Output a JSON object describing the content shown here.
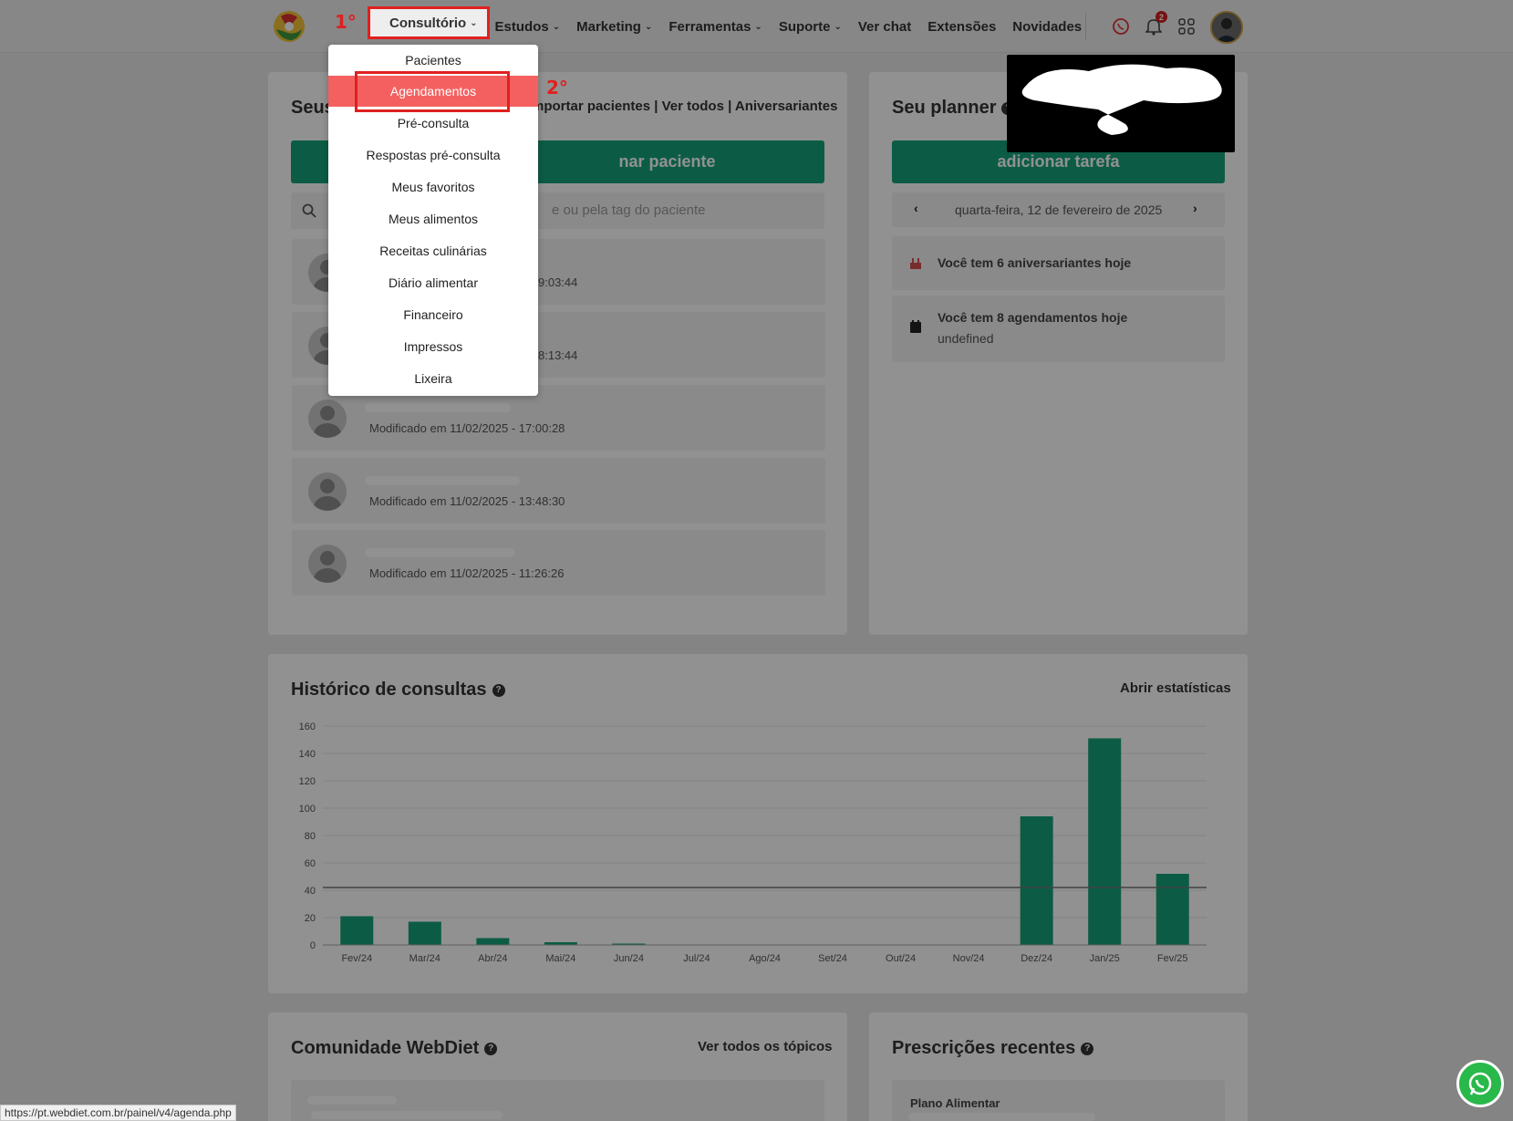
{
  "nav": {
    "items": [
      {
        "label": "Consultório",
        "has_chevron": true
      },
      {
        "label": "Estudos",
        "has_chevron": true
      },
      {
        "label": "Marketing",
        "has_chevron": true
      },
      {
        "label": "Ferramentas",
        "has_chevron": true
      },
      {
        "label": "Suporte",
        "has_chevron": true
      },
      {
        "label": "Ver chat",
        "has_chevron": false
      },
      {
        "label": "Extensões",
        "has_chevron": false
      },
      {
        "label": "Novidades",
        "has_chevron": false
      }
    ],
    "notification_count": "2"
  },
  "dropdown": {
    "items": [
      "Pacientes",
      "Agendamentos",
      "Pré-consulta",
      "Respostas pré-consulta",
      "Meus favoritos",
      "Meus alimentos",
      "Receitas culinárias",
      "Diário alimentar",
      "Financeiro",
      "Impressos",
      "Lixeira"
    ],
    "active_index": 1
  },
  "annotations": {
    "step1": "1°",
    "step2": "2°"
  },
  "patients_card": {
    "title_visible": "Seus",
    "links": "mportar pacientes | Ver todos | Aniversariantes",
    "add_button": "nar paciente",
    "search_placeholder": "e ou pela tag do paciente",
    "rows": [
      {
        "modified": "9:03:44"
      },
      {
        "modified": "8:13:44"
      },
      {
        "modified": "Modificado em 11/02/2025 - 17:00:28"
      },
      {
        "modified": "Modificado em 11/02/2025 - 13:48:30"
      },
      {
        "modified": "Modificado em 11/02/2025 - 11:26:26"
      }
    ]
  },
  "planner_card": {
    "title": "Seu planner",
    "add_button": "adicionar tarefa",
    "date": "quarta-feira, 12 de fevereiro de 2025",
    "birthdays": "Você tem 6 aniversariantes hoje",
    "appointments": "Você tem 8 agendamentos hoje",
    "appointments_sub": "undefined"
  },
  "history_card": {
    "title": "Histórico de consultas",
    "link": "Abrir estatísticas"
  },
  "chart_data": {
    "type": "bar",
    "categories": [
      "Fev/24",
      "Mar/24",
      "Abr/24",
      "Mai/24",
      "Jun/24",
      "Jul/24",
      "Ago/24",
      "Set/24",
      "Out/24",
      "Nov/24",
      "Dez/24",
      "Jan/25",
      "Fev/25"
    ],
    "values": [
      21,
      17,
      5,
      2,
      1,
      0,
      0,
      0,
      0,
      0,
      94,
      151,
      52
    ],
    "average_line": 42,
    "ylim": [
      0,
      160
    ],
    "yticks": [
      0,
      20,
      40,
      60,
      80,
      100,
      120,
      140,
      160
    ],
    "bar_color": "#16a37a",
    "grid": true
  },
  "community_card": {
    "title": "Comunidade WebDiet",
    "link": "Ver todos os tópicos"
  },
  "prescriptions_card": {
    "title": "Prescrições recentes",
    "item_label": "Plano Alimentar"
  },
  "status_bar": {
    "url": "https://pt.webdiet.com.br/painel/v4/agenda.php"
  },
  "colors": {
    "accent": "#16a37a",
    "highlight": "#f46060",
    "annotation": "#e02020"
  }
}
